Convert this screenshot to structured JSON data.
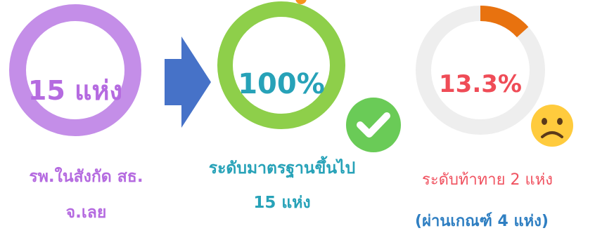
{
  "panel1": {
    "center": "15 แห่ง",
    "caption_line1": "รพ.ในสังกัด สธ.",
    "caption_line2": "จ.เลย",
    "ring_color": "#C48EE8",
    "text_color": "#B56BE0"
  },
  "arrow": {
    "color": "#4672C8",
    "icon": "right-arrow"
  },
  "panel2": {
    "center": "100%",
    "caption_line1": "ระดับมาตรฐานขึ้นไป",
    "caption_line2": "15 แห่ง",
    "ring_color": "#8ECF4A",
    "text_color": "#27A2B8",
    "badge_color": "#6ACB57",
    "badge_icon": "check-circle"
  },
  "panel3": {
    "center": "13.3%",
    "progress": 0.133,
    "caption_line1": "ระดับท้าทาย 2 แห่ง",
    "caption_line2": "(ผ่านเกณฑ์ 4 แห่ง)",
    "ring_color": "#EEEEEE",
    "progress_color": "#E8720F",
    "text_color": "#EF4C57",
    "caption1_color": "#F05260",
    "caption2_color": "#2F7FC2",
    "emoji_icon": "sad-face"
  }
}
